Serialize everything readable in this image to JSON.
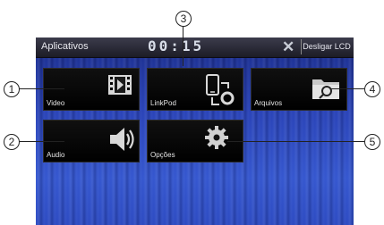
{
  "header": {
    "title": "Aplicativos",
    "clock": "00:15",
    "lcd_button": "Desligar LCD"
  },
  "tiles": [
    {
      "label": "Video",
      "icon": "film-icon"
    },
    {
      "label": "LinkPod",
      "icon": "device-link-icon"
    },
    {
      "label": "Arquivos",
      "icon": "folder-search-icon"
    },
    {
      "label": "Audio",
      "icon": "speaker-icon"
    },
    {
      "label": "Opções",
      "icon": "gear-icon"
    }
  ],
  "callouts": [
    "1",
    "2",
    "3",
    "4",
    "5"
  ],
  "colors": {
    "screen": "#2a44b8",
    "tile": "#000000",
    "bar": "#2a2a38"
  }
}
